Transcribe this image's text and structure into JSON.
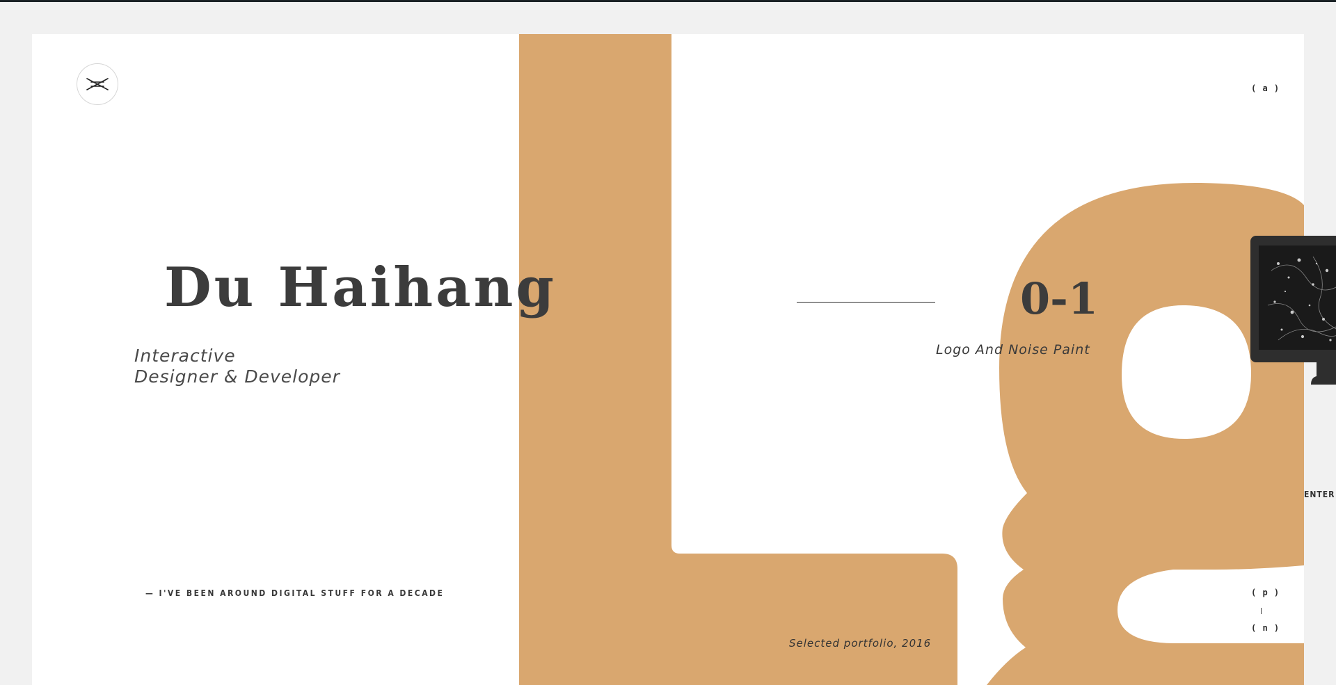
{
  "hero": {
    "name": "Du Haihang",
    "role_line1": "Interactive",
    "role_line2": "Designer & Developer",
    "tagline": "— I'VE BEEN AROUND DIGITAL STUFF FOR A DECADE"
  },
  "project": {
    "number": "0-1",
    "title": "Logo And Noise Paint",
    "caption": "Selected portfolio, 2016",
    "background_letters": "Lg"
  },
  "nav": {
    "about_key": "( a )",
    "prev_key": "( p )",
    "separator": "|",
    "next_key": "( n )",
    "enter_label": "ENTER C"
  },
  "colors": {
    "accent": "#d9a76f",
    "text_dark": "#3c3c3c",
    "page_bg": "#f1f1f1",
    "card_bg": "#ffffff",
    "thumb_bg": "#2e2e2e"
  },
  "icons": {
    "logo": "crossed-lines-logo-icon",
    "thumbnail": "noise-paint-screen-thumbnail"
  }
}
